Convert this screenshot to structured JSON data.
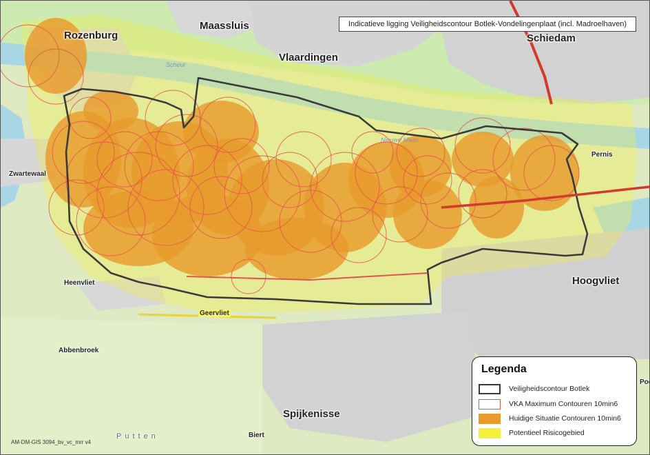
{
  "title": "Indicatieve ligging Veiligheidscontour Botlek-Vondelingenplaat (incl. Madroelhaven)",
  "map_code": "AM-DM-GIS 3094_bv_vc_mrr v4",
  "places": {
    "rozenburg": "Rozenburg",
    "maassluis": "Maassluis",
    "vlaardingen": "Vlaardingen",
    "schiedam": "Schiedam",
    "zwartewaal": "Zwartewaal",
    "pernis": "Pernis",
    "hoogvliet": "Hoogvliet",
    "heenvliet": "Heenvliet",
    "geervliet": "Geervliet",
    "abbenbroek": "Abbenbroek",
    "spijkenisse": "Spijkenisse",
    "biert": "Biert",
    "putten": "Putten",
    "poo": "Poo",
    "scheur": "Scheur",
    "nieuwe_maas": "Nieuwe Maas"
  },
  "legend": {
    "title": "Legenda",
    "items": [
      {
        "label": "Veiligheidscontour Botlek",
        "style": "outline",
        "color": "#3a3a3a"
      },
      {
        "label": "VKA Maximum Contouren 10min6",
        "style": "outline",
        "color": "#e8524a"
      },
      {
        "label": "Huidige Situatie Contouren 10min6",
        "style": "fill",
        "color": "#e89a2c"
      },
      {
        "label": "Potentieel Risicogebied",
        "style": "fill",
        "color": "#f6f03a"
      }
    ]
  },
  "colors": {
    "contour": "#3a3a3a",
    "vka": "#e8524a",
    "huidige": "#e89a2c",
    "risico": "#f6f03a",
    "water": "#a9d6e5",
    "urban": "#cfcfcf",
    "green": "#b7dd8c"
  }
}
